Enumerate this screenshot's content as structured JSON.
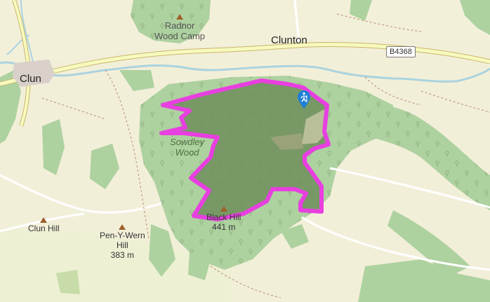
{
  "map": {
    "places": {
      "clun": "Clun",
      "clunton": "Clunton"
    },
    "woods": {
      "radnor": [
        "Radnor",
        "Wood Camp"
      ],
      "sowdley": [
        "Sowdley",
        "Wood"
      ]
    },
    "peaks": {
      "black_hill": [
        "Black Hill",
        "441 m"
      ],
      "clun_hill": [
        "Clun Hill"
      ],
      "pen_y_wern": [
        "Pen-Y-Wern",
        "Hill",
        "383 m"
      ]
    },
    "roads": {
      "b4368": "B4368"
    },
    "route": {
      "color": "#e83fe0",
      "start_icon": "hiker-icon"
    },
    "colors": {
      "background": "#f2efd9",
      "woodland": "#aed1a0",
      "woodland_dark": "#8fb87f",
      "river": "#aad3df",
      "main_road": "#f7fabf",
      "route": "#e83fe0",
      "marker": "#1f7fd6"
    }
  }
}
